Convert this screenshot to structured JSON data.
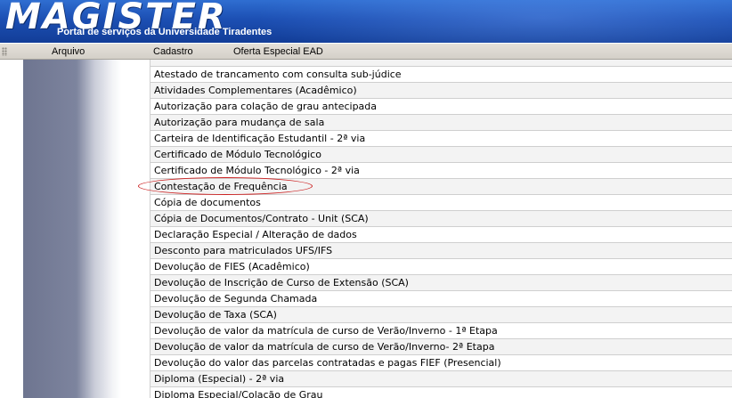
{
  "header": {
    "app_title": "MAGISTER",
    "subtitle": "Portal de serviços da Universidade Tiradentes"
  },
  "menu": {
    "items": [
      {
        "label": "Arquivo"
      },
      {
        "label": "Cadastro"
      },
      {
        "label": "Oferta Especial EAD"
      }
    ]
  },
  "services": {
    "items": [
      "Atestado de trancamento com consulta sub-júdice",
      "Atividades Complementares (Acadêmico)",
      "Autorização para colação de grau antecipada",
      "Autorização para mudança de sala",
      "Carteira de Identificação Estudantil - 2ª via",
      "Certificado de Módulo Tecnológico",
      "Certificado de Módulo Tecnológico - 2ª via",
      "Contestação de Frequência",
      "Cópia de documentos",
      "Cópia de Documentos/Contrato - Unit (SCA)",
      "Declaração Especial / Alteração de dados",
      "Desconto para matriculados UFS/IFS",
      "Devolução de FIES (Acadêmico)",
      "Devolução de Inscrição de Curso de Extensão (SCA)",
      "Devolução de Segunda Chamada",
      "Devolução de Taxa (SCA)",
      "Devolução de valor da matrícula de curso de Verão/Inverno - 1ª Etapa",
      "Devolução de valor da matrícula de curso de Verão/Inverno- 2ª Etapa",
      "Devolução do valor das parcelas contratadas e pagas FIEF (Presencial)",
      "Diploma (Especial) - 2ª via",
      "Diploma Especial/Colação de Grau"
    ],
    "highlighted_item": "Contestação de Frequência",
    "highlight_color": "#cc2222"
  },
  "colors": {
    "banner": "#1c4fb3",
    "menubar": "#d4d0c8",
    "left_strip": "#6e7590"
  }
}
